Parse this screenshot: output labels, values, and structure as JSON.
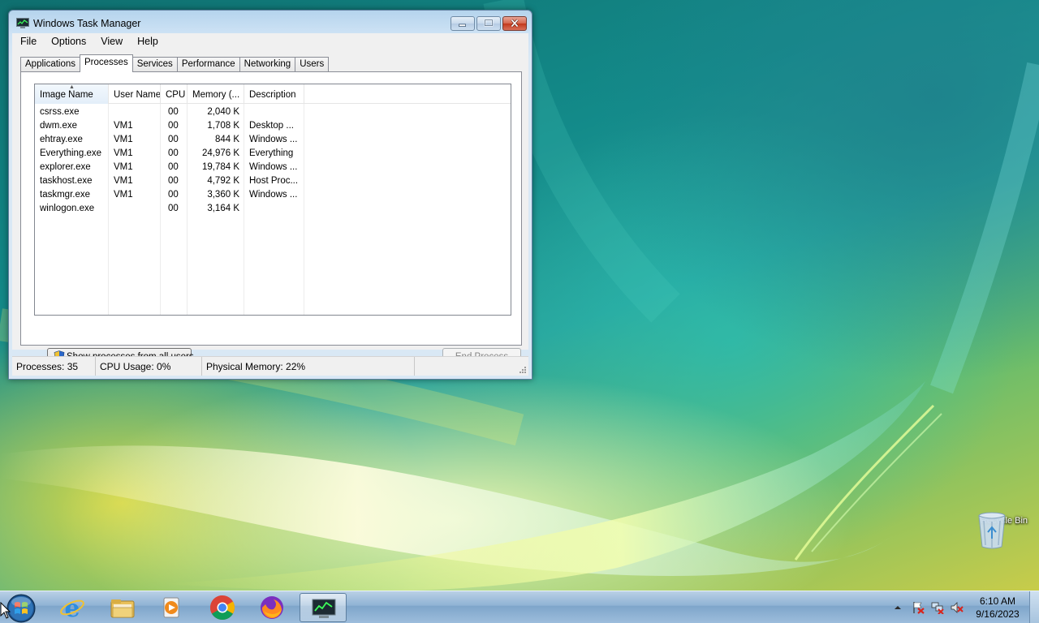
{
  "window": {
    "title": "Windows Task Manager",
    "menu": [
      "File",
      "Options",
      "View",
      "Help"
    ],
    "tabs": [
      "Applications",
      "Processes",
      "Services",
      "Performance",
      "Networking",
      "Users"
    ],
    "active_tab": "Processes"
  },
  "process_list": {
    "columns": [
      "Image Name",
      "User Name",
      "CPU",
      "Memory (...",
      "Description"
    ],
    "sorted_column": "Image Name",
    "rows": [
      {
        "image": "csrss.exe",
        "user": "",
        "cpu": "00",
        "memory": "2,040 K",
        "description": ""
      },
      {
        "image": "dwm.exe",
        "user": "VM1",
        "cpu": "00",
        "memory": "1,708 K",
        "description": "Desktop ..."
      },
      {
        "image": "ehtray.exe",
        "user": "VM1",
        "cpu": "00",
        "memory": "844 K",
        "description": "Windows ..."
      },
      {
        "image": "Everything.exe",
        "user": "VM1",
        "cpu": "00",
        "memory": "24,976 K",
        "description": "Everything"
      },
      {
        "image": "explorer.exe",
        "user": "VM1",
        "cpu": "00",
        "memory": "19,784 K",
        "description": "Windows ..."
      },
      {
        "image": "taskhost.exe",
        "user": "VM1",
        "cpu": "00",
        "memory": "4,792 K",
        "description": "Host Proc..."
      },
      {
        "image": "taskmgr.exe",
        "user": "VM1",
        "cpu": "00",
        "memory": "3,360 K",
        "description": "Windows ..."
      },
      {
        "image": "winlogon.exe",
        "user": "",
        "cpu": "00",
        "memory": "3,164 K",
        "description": ""
      }
    ]
  },
  "buttons": {
    "show_all": "Show processes from all users",
    "end_process": "End Process"
  },
  "status": {
    "processes": "Processes: 35",
    "cpu": "CPU Usage: 0%",
    "memory": "Physical Memory: 22%"
  },
  "desktop": {
    "recycle_bin": "Recycle Bin"
  },
  "taskbar": {
    "pinned": [
      "internet-explorer-icon",
      "file-explorer-icon",
      "media-player-icon",
      "chrome-icon",
      "firefox-icon",
      "task-manager-icon"
    ],
    "time": "6:10 AM",
    "date": "9/16/2023"
  }
}
